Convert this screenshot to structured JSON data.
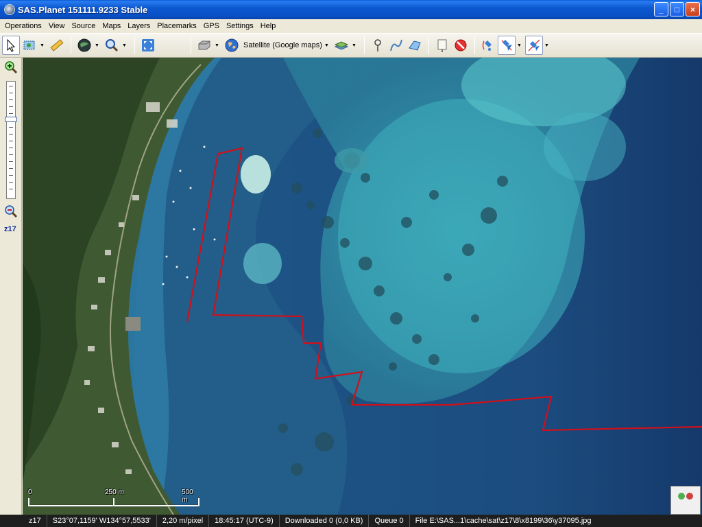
{
  "window": {
    "title": "SAS.Planet 151111.9233 Stable",
    "buttons": {
      "minimize": "_",
      "maximize": "□",
      "close": "×"
    }
  },
  "menu": {
    "items": [
      "Operations",
      "View",
      "Source",
      "Maps",
      "Layers",
      "Placemarks",
      "GPS",
      "Settings",
      "Help"
    ]
  },
  "toolbar": {
    "map_source": "Satellite (Google maps)",
    "dropdown_glyph": "▼"
  },
  "zoom": {
    "level_label": "z17"
  },
  "map": {
    "scale_labels": [
      "0",
      "250 m",
      "500 m"
    ],
    "border_color": "#d0101a"
  },
  "status": {
    "zoom": "z17",
    "coordinates": "S23°07,1159' W134°57,5533'",
    "resolution": "2,20 m/pixel",
    "time": "18:45:17 (UTC-9)",
    "downloaded": "Downloaded 0 (0,0 KB)",
    "queue": "Queue 0",
    "file": "File E:\\SAS...1\\cache\\sat\\z17\\8\\x8199\\36\\y37095.jpg"
  }
}
